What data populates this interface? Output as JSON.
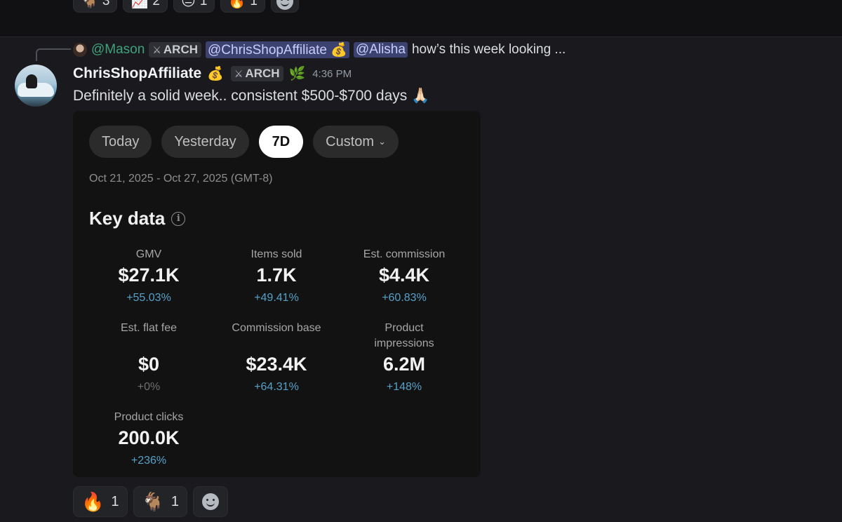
{
  "top_reactions": [
    {
      "emoji": "🐐",
      "count": "3"
    },
    {
      "emoji": "📈",
      "count": "2"
    },
    {
      "emoji": "😑",
      "count": "1"
    },
    {
      "emoji": "🔥",
      "count": "1"
    }
  ],
  "reply": {
    "author": "@Mason",
    "role": "ARCH",
    "mention_1": "@ChrisShopAffiliate 💰",
    "mention_2": "@Alisha",
    "text": "how’s this week looking ..."
  },
  "message": {
    "author": "ChrisShopAffiliate",
    "author_emoji": "💰",
    "role": "ARCH",
    "extra_badge_emoji": "🌿",
    "timestamp": "4:36 PM",
    "text": "Definitely a solid week.. consistent $500-$700 days 🙏🏻"
  },
  "card": {
    "tabs": [
      {
        "label": "Today",
        "active": false
      },
      {
        "label": "Yesterday",
        "active": false
      },
      {
        "label": "7D",
        "active": true
      },
      {
        "label": "Custom",
        "active": false
      }
    ],
    "date_range": "Oct 21, 2025 - Oct 27, 2025 (GMT-8)",
    "section_title": "Key data",
    "metrics": [
      {
        "label": "GMV",
        "value": "$27.1K",
        "change": "+55.03%"
      },
      {
        "label": "Items sold",
        "value": "1.7K",
        "change": "+49.41%"
      },
      {
        "label": "Est. commission",
        "value": "$4.4K",
        "change": "+60.83%"
      },
      {
        "label": "Est. flat fee",
        "value": "$0",
        "change": "+0%"
      },
      {
        "label": "Commission base",
        "value": "$23.4K",
        "change": "+64.31%"
      },
      {
        "label": "Product impressions",
        "value": "6.2M",
        "change": "+148%"
      },
      {
        "label": "Product clicks",
        "value": "200.0K",
        "change": "+236%"
      }
    ]
  },
  "bottom_reactions": [
    {
      "emoji": "🔥",
      "count": "1"
    },
    {
      "emoji": "🐐",
      "count": "1"
    }
  ],
  "colors": {
    "background": "#1a1a1e",
    "card": "#121212",
    "positive_change": "#58a0c8",
    "mention_bg": "#3c4270",
    "author_green": "#3fa27a"
  }
}
